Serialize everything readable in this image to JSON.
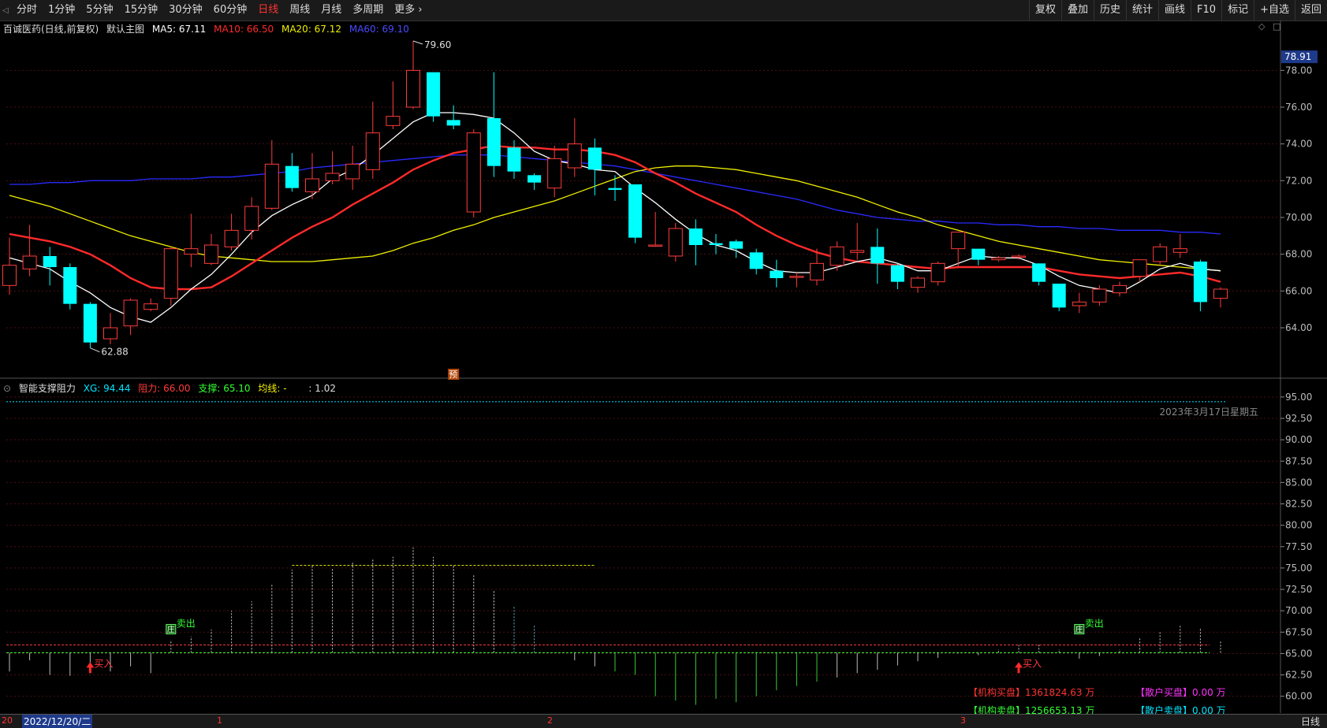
{
  "toolbar": {
    "periods": [
      "分时",
      "1分钟",
      "5分钟",
      "15分钟",
      "30分钟",
      "60分钟",
      "日线",
      "周线",
      "月线",
      "多周期",
      "更多 ›"
    ],
    "active_period": "日线",
    "right_buttons": [
      "复权",
      "叠加",
      "历史",
      "统计",
      "画线",
      "F10",
      "标记",
      "+自选",
      "返回"
    ]
  },
  "main_info": {
    "stock": "百诚医药(日线,前复权)",
    "chart_name": "默认主图",
    "ma5": "MA5: 67.11",
    "ma10": "MA10: 66.50",
    "ma20": "MA20: 67.12",
    "ma60": "MA60: 69.10",
    "colors": {
      "ma5": "#ffffff",
      "ma10": "#ff2a2a",
      "ma20": "#f0f000",
      "ma60": "#2a2aff",
      "up": "#ff3b3b",
      "down": "#00ffff"
    }
  },
  "indicator_info": {
    "name": "智能支撑阻力",
    "xg": "XG: 94.44",
    "resist": "阻力: 66.00",
    "support": "支撑: 65.10",
    "avg": "均线: -",
    "ratio": ": 1.02",
    "date_label": "2023年3月17日星期五",
    "buy_label": "买入",
    "sell_label": "卖出",
    "zhuang_label": "庄",
    "pre_label": "预"
  },
  "legend": {
    "inst_buy": "【机构买盘】1361824.63 万",
    "inst_sell": "【机构卖盘】1256653.13 万",
    "retail_buy": "【散户买盘】0.00 万",
    "retail_sell": "【散户卖盘】0.00 万"
  },
  "statusbar": {
    "start_label": "20",
    "date_label": "2022/12/20/二",
    "months": [
      "1",
      "2",
      "3"
    ],
    "period": "日线"
  },
  "chart_data": [
    {
      "type": "candlestick",
      "ylim": [
        62.8,
        79.6
      ],
      "y_ticks": [
        "78.00",
        "76.00",
        "74.00",
        "72.00",
        "70.00",
        "68.00",
        "66.00",
        "64.00"
      ],
      "current_price": "78.91",
      "max_label": "79.60",
      "min_label": "62.88",
      "candles": [
        [
          66.3,
          67.4,
          68.9,
          65.8
        ],
        [
          67.2,
          67.9,
          69.6,
          66.8
        ],
        [
          67.9,
          67.3,
          68.4,
          66.3
        ],
        [
          67.3,
          65.3,
          67.5,
          65.0
        ],
        [
          65.3,
          63.2,
          65.4,
          62.9
        ],
        [
          63.4,
          64.0,
          64.8,
          63.1
        ],
        [
          64.1,
          65.5,
          65.6,
          63.6
        ],
        [
          65.0,
          65.3,
          65.6,
          64.9
        ],
        [
          65.6,
          68.3,
          68.4,
          65.2
        ],
        [
          68.0,
          68.3,
          70.2,
          67.3
        ],
        [
          67.5,
          68.5,
          69.1,
          67.4
        ],
        [
          68.4,
          69.3,
          70.2,
          68.2
        ],
        [
          69.3,
          70.6,
          71.1,
          68.8
        ],
        [
          70.5,
          72.9,
          74.2,
          70.4
        ],
        [
          72.8,
          71.6,
          73.5,
          71.4
        ],
        [
          71.4,
          72.1,
          73.5,
          71.0
        ],
        [
          72.0,
          72.4,
          73.6,
          71.8
        ],
        [
          72.1,
          72.9,
          73.9,
          71.5
        ],
        [
          72.6,
          74.6,
          76.3,
          72.1
        ],
        [
          75.0,
          75.5,
          77.4,
          74.8
        ],
        [
          76.0,
          78.0,
          79.6,
          75.9
        ],
        [
          77.9,
          75.5,
          77.9,
          75.2
        ],
        [
          75.3,
          75.0,
          76.1,
          74.8
        ],
        [
          70.3,
          74.6,
          74.8,
          70.0
        ],
        [
          75.4,
          72.8,
          77.9,
          72.2
        ],
        [
          73.8,
          72.5,
          74.2,
          72.1
        ],
        [
          72.3,
          71.9,
          72.4,
          71.5
        ],
        [
          71.6,
          73.2,
          73.9,
          71.1
        ],
        [
          72.7,
          74.0,
          75.4,
          72.2
        ],
        [
          73.8,
          72.6,
          74.3,
          71.2
        ],
        [
          71.6,
          71.5,
          72.3,
          70.9
        ],
        [
          71.8,
          68.9,
          71.7,
          68.6
        ],
        [
          68.5,
          68.5,
          70.3,
          68.4
        ],
        [
          67.9,
          69.4,
          69.7,
          67.6
        ],
        [
          69.4,
          68.5,
          69.9,
          67.4
        ],
        [
          68.6,
          68.5,
          69.1,
          68.0
        ],
        [
          68.7,
          68.3,
          68.8,
          67.8
        ],
        [
          68.1,
          67.2,
          68.3,
          66.9
        ],
        [
          67.1,
          66.7,
          67.7,
          66.2
        ],
        [
          66.8,
          66.8,
          67.0,
          66.2
        ],
        [
          66.6,
          67.5,
          68.3,
          66.3
        ],
        [
          67.4,
          68.4,
          68.7,
          67.1
        ],
        [
          68.1,
          68.2,
          69.7,
          67.7
        ],
        [
          68.4,
          67.5,
          69.4,
          66.4
        ],
        [
          67.4,
          66.5,
          67.5,
          66.1
        ],
        [
          66.2,
          66.7,
          66.8,
          65.9
        ],
        [
          66.5,
          67.5,
          67.6,
          66.3
        ],
        [
          68.3,
          69.2,
          69.2,
          67.3
        ],
        [
          68.3,
          67.7,
          68.3,
          67.4
        ],
        [
          67.7,
          67.8,
          67.9,
          67.6
        ],
        [
          67.9,
          67.9,
          68.0,
          67.7
        ],
        [
          67.5,
          66.5,
          67.5,
          66.3
        ],
        [
          66.4,
          65.1,
          66.4,
          64.9
        ],
        [
          65.2,
          65.4,
          65.9,
          64.8
        ],
        [
          65.4,
          66.1,
          66.3,
          65.2
        ],
        [
          65.9,
          66.3,
          66.5,
          65.7
        ],
        [
          66.8,
          67.7,
          67.7,
          66.5
        ],
        [
          67.6,
          68.4,
          68.6,
          67.4
        ],
        [
          68.1,
          68.3,
          69.1,
          67.8
        ],
        [
          67.6,
          65.4,
          67.7,
          64.9
        ],
        [
          65.6,
          66.1,
          66.2,
          65.1
        ]
      ],
      "ma5": [
        67.8,
        67.5,
        67.2,
        66.5,
        65.9,
        65.1,
        64.6,
        64.3,
        65.1,
        66.1,
        66.9,
        68.0,
        69.2,
        70.1,
        70.7,
        71.2,
        72.1,
        72.6,
        73.4,
        74.3,
        75.2,
        75.7,
        75.7,
        75.6,
        75.4,
        74.6,
        73.6,
        73.1,
        72.9,
        72.6,
        72.5,
        71.6,
        70.8,
        69.9,
        69.1,
        68.5,
        68.2,
        67.6,
        67.1,
        67.0,
        67.0,
        67.3,
        67.6,
        67.8,
        67.5,
        67.1,
        67.1,
        67.5,
        67.9,
        67.8,
        67.8,
        67.4,
        66.8,
        66.3,
        66.1,
        65.9,
        66.5,
        67.2,
        67.5,
        67.2,
        67.1
      ],
      "ma10": [
        69.1,
        68.9,
        68.7,
        68.4,
        68.0,
        67.4,
        66.7,
        66.2,
        66.1,
        66.1,
        66.2,
        66.8,
        67.5,
        68.2,
        68.9,
        69.5,
        70.0,
        70.7,
        71.3,
        71.9,
        72.6,
        73.1,
        73.5,
        73.7,
        73.9,
        73.8,
        73.8,
        73.7,
        73.7,
        73.6,
        73.4,
        73.0,
        72.4,
        71.9,
        71.3,
        70.8,
        70.3,
        69.6,
        69.0,
        68.5,
        68.1,
        67.8,
        67.6,
        67.5,
        67.4,
        67.3,
        67.2,
        67.3,
        67.3,
        67.3,
        67.3,
        67.3,
        67.1,
        66.9,
        66.8,
        66.7,
        66.8,
        66.9,
        67.0,
        66.8,
        66.5
      ],
      "ma20": [
        71.2,
        70.9,
        70.6,
        70.2,
        69.8,
        69.4,
        69.0,
        68.7,
        68.4,
        68.1,
        67.9,
        67.8,
        67.7,
        67.6,
        67.6,
        67.6,
        67.7,
        67.8,
        67.9,
        68.2,
        68.6,
        68.9,
        69.3,
        69.6,
        70.0,
        70.3,
        70.6,
        70.9,
        71.3,
        71.7,
        72.1,
        72.5,
        72.7,
        72.8,
        72.8,
        72.7,
        72.6,
        72.4,
        72.2,
        72.0,
        71.7,
        71.4,
        71.1,
        70.7,
        70.3,
        70.0,
        69.6,
        69.3,
        69.0,
        68.7,
        68.5,
        68.3,
        68.1,
        67.9,
        67.7,
        67.6,
        67.5,
        67.4,
        67.3,
        67.2,
        67.1
      ],
      "ma60": [
        71.8,
        71.8,
        71.9,
        71.9,
        72.0,
        72.0,
        72.0,
        72.1,
        72.1,
        72.1,
        72.2,
        72.2,
        72.3,
        72.4,
        72.5,
        72.7,
        72.8,
        72.9,
        73.0,
        73.1,
        73.2,
        73.3,
        73.4,
        73.4,
        73.4,
        73.3,
        73.2,
        73.1,
        73.0,
        72.9,
        72.8,
        72.6,
        72.4,
        72.2,
        72.0,
        71.8,
        71.6,
        71.4,
        71.2,
        71.0,
        70.7,
        70.4,
        70.2,
        70.0,
        69.9,
        69.8,
        69.8,
        69.7,
        69.7,
        69.6,
        69.6,
        69.5,
        69.5,
        69.4,
        69.4,
        69.3,
        69.3,
        69.3,
        69.2,
        69.2,
        69.1
      ]
    },
    {
      "type": "indicator",
      "ylim": [
        58.5,
        96.0
      ],
      "y_ticks": [
        "95.00",
        "92.50",
        "90.00",
        "87.50",
        "85.00",
        "82.50",
        "80.00",
        "77.50",
        "75.00",
        "72.50",
        "70.00",
        "67.50",
        "65.00",
        "62.50",
        "60.00"
      ],
      "xg_level": 94.44,
      "resist_level": 66.0,
      "support_level": 65.1,
      "yellow_resist": {
        "from": 14,
        "to": 29,
        "value": 75.3
      },
      "bars": [
        62.9,
        64.2,
        62.5,
        62.4,
        63.3,
        62.9,
        63.5,
        62.7,
        66.6,
        67.0,
        67.8,
        70.0,
        71.1,
        73.1,
        74.8,
        75.3,
        74.9,
        75.6,
        76.0,
        76.3,
        77.4,
        76.3,
        75.3,
        74.2,
        72.4,
        70.5,
        68.4,
        65.1,
        64.2,
        63.5,
        62.9,
        62.5,
        60.0,
        59.5,
        59.0,
        59.7,
        59.3,
        60.0,
        60.7,
        61.2,
        61.7,
        62.2,
        62.7,
        63.1,
        63.6,
        64.1,
        64.5,
        65.0,
        64.8,
        65.5,
        66.0,
        66.2,
        65.5,
        64.4,
        64.7,
        65.5,
        66.9,
        67.5,
        68.3,
        68.0,
        66.4
      ],
      "buy_points": [
        4,
        50
      ],
      "sell_points": [
        8,
        53
      ]
    }
  ]
}
